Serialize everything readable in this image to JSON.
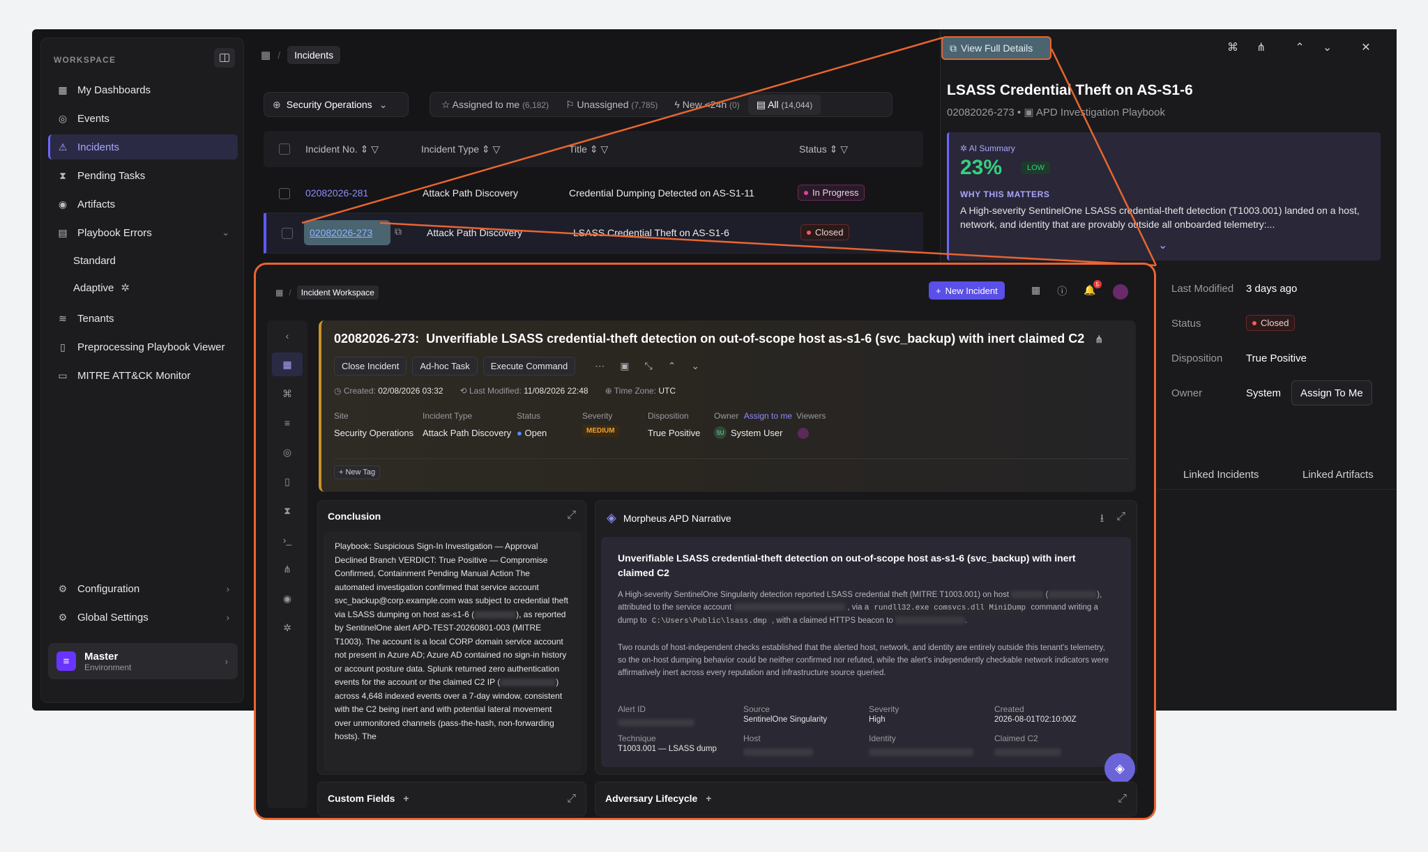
{
  "sidebar": {
    "workspace_label": "WORKSPACE",
    "items": [
      {
        "label": "My Dashboards",
        "icon": "grid-icon"
      },
      {
        "label": "Events",
        "icon": "target-icon"
      },
      {
        "label": "Incidents",
        "icon": "warning-icon"
      },
      {
        "label": "Pending Tasks",
        "icon": "hourglass-icon"
      },
      {
        "label": "Artifacts",
        "icon": "fingerprint-icon"
      },
      {
        "label": "Playbook Errors",
        "icon": "playbook-icon"
      },
      {
        "label": "Standard"
      },
      {
        "label": "Adaptive"
      },
      {
        "label": "Tenants",
        "icon": "layers-icon"
      },
      {
        "label": "Preprocessing Playbook Viewer",
        "icon": "book-icon"
      },
      {
        "label": "MITRE ATT&CK Monitor",
        "icon": "monitor-icon"
      }
    ],
    "configuration": "Configuration",
    "global_settings": "Global Settings",
    "env_name": "Master",
    "env_sub": "Environment"
  },
  "main": {
    "breadcrumb": "Incidents",
    "site_select": "Security Operations",
    "filters": [
      {
        "label": "Assigned to me",
        "count": "(6,182)"
      },
      {
        "label": "Unassigned",
        "count": "(7,785)"
      },
      {
        "label": "New <24h",
        "count": "(0)"
      },
      {
        "label": "All",
        "count": "(14,044)"
      }
    ],
    "columns": [
      "Incident No.",
      "Incident Type",
      "Title",
      "Status"
    ],
    "rows": [
      {
        "no": "02082026-281",
        "type": "Attack Path Discovery",
        "title": "Credential Dumping Detected on AS-S1-11",
        "status": "In Progress"
      },
      {
        "no": "02082026-273",
        "type": "Attack Path Discovery",
        "title": "LSASS Credential Theft on AS-S1-6",
        "status": "Closed"
      }
    ]
  },
  "panel": {
    "view_full_details": "View Full Details",
    "title": "LSASS Credential Theft on AS-S1-6",
    "id": "02082026-273",
    "playbook": "APD Investigation Playbook",
    "ai_label": "AI Summary",
    "ai_percent": "23%",
    "ai_level": "LOW",
    "why_label": "WHY THIS MATTERS",
    "why_text": "A High-severity SentinelOne LSASS credential-theft detection (T1003.001) landed on a host, network, and identity that are provably outside all onboarded telemetry:...",
    "last_modified_label": "Last Modified",
    "last_modified": "3 days ago",
    "status_label": "Status",
    "status": "Closed",
    "disposition_label": "Disposition",
    "disposition": "True Positive",
    "owner_label": "Owner",
    "owner": "System",
    "assign_btn": "Assign To Me",
    "tabs": [
      "Linked Incidents",
      "Linked Artifacts"
    ]
  },
  "workspace": {
    "breadcrumb": "Incident Workspace",
    "new_incident": "New Incident",
    "notif_count": "5",
    "title_id": "02082026-273:",
    "title": "Unverifiable LSASS credential-theft detection on out-of-scope host as-s1-6 (svc_backup) with inert claimed C2",
    "actions": [
      "Close Incident",
      "Ad-hoc Task",
      "Execute Command"
    ],
    "created_label": "Created:",
    "created": "02/08/2026 03:32",
    "modified_label": "Last Modified:",
    "modified": "11/08/2026 22:48",
    "tz_label": "Time Zone:",
    "tz": "UTC",
    "fields": [
      {
        "label": "Site",
        "value": "Security Operations"
      },
      {
        "label": "Incident Type",
        "value": "Attack Path Discovery"
      },
      {
        "label": "Status",
        "value": "Open"
      },
      {
        "label": "Severity",
        "value": "MEDIUM"
      },
      {
        "label": "Disposition",
        "value": "True Positive"
      },
      {
        "label": "Owner",
        "value": "System User",
        "extra": "Assign to me",
        "initials": "SU"
      },
      {
        "label": "Viewers",
        "value": ""
      }
    ],
    "new_tag": "New Tag",
    "conclusion_title": "Conclusion",
    "conclusion_text_1": "Playbook: Suspicious Sign-In Investigation — Approval Declined Branch VERDICT: True Positive — Compromise Confirmed, Containment Pending Manual Action The automated investigation confirmed that service account svc_backup@corp.example.com was subject to credential theft via LSASS dumping on host as-s1-6 (",
    "conclusion_text_2": "), as reported by SentinelOne alert APD-TEST-20260801-003 (MITRE T1003). The account is a local CORP domain service account not present in Azure AD; Azure AD contained no sign-in history or account posture data. Splunk returned zero authentication events for the account or the claimed C2 IP (",
    "conclusion_text_3": ") across 4,648 indexed events over a 7-day window, consistent with the C2 being inert and with potential lateral movement over unmonitored channels (pass-the-hash, non-forwarding hosts). The",
    "narrative_title": "Morpheus APD Narrative",
    "narrative_heading": "Unverifiable LSASS credential-theft detection on out-of-scope host as-s1-6 (svc_backup) with inert claimed C2",
    "narrative_p1_a": "A High-severity SentinelOne Singularity detection reported LSASS credential theft (MITRE T1003.001) on host",
    "narrative_p1_b": "), attributed to the service account",
    "narrative_p1_c": ", via a",
    "narrative_cmd1": "rundll32.exe comsvcs.dll MiniDump",
    "narrative_p1_d": "command writing a dump to",
    "narrative_cmd2": "C:\\Users\\Public\\lsass.dmp",
    "narrative_p1_e": ", with a claimed HTTPS beacon to",
    "narrative_p2": "Two rounds of host-independent checks established that the alerted host, network, and identity are entirely outside this tenant's telemetry, so the on-host dumping behavior could be neither confirmed nor refuted, while the alert's independently checkable network indicators were affirmatively inert across every reputation and infrastructure source queried.",
    "grid": [
      {
        "label": "Alert ID",
        "value": ""
      },
      {
        "label": "Source",
        "value": "SentinelOne Singularity"
      },
      {
        "label": "Severity",
        "value": "High"
      },
      {
        "label": "Created",
        "value": "2026-08-01T02:10:00Z"
      },
      {
        "label": "Technique",
        "value": "T1003.001 — LSASS dump"
      },
      {
        "label": "Host",
        "value": ""
      },
      {
        "label": "Identity",
        "value": ""
      },
      {
        "label": "Claimed C2",
        "value": ""
      }
    ],
    "custom_fields": "Custom Fields",
    "adversary_lifecycle": "Adversary Lifecycle"
  },
  "colors": {
    "accent": "#6d68ff",
    "highlight": "#e9652f",
    "ai_green": "#35d07f",
    "closed_red": "#ff5a5a"
  }
}
